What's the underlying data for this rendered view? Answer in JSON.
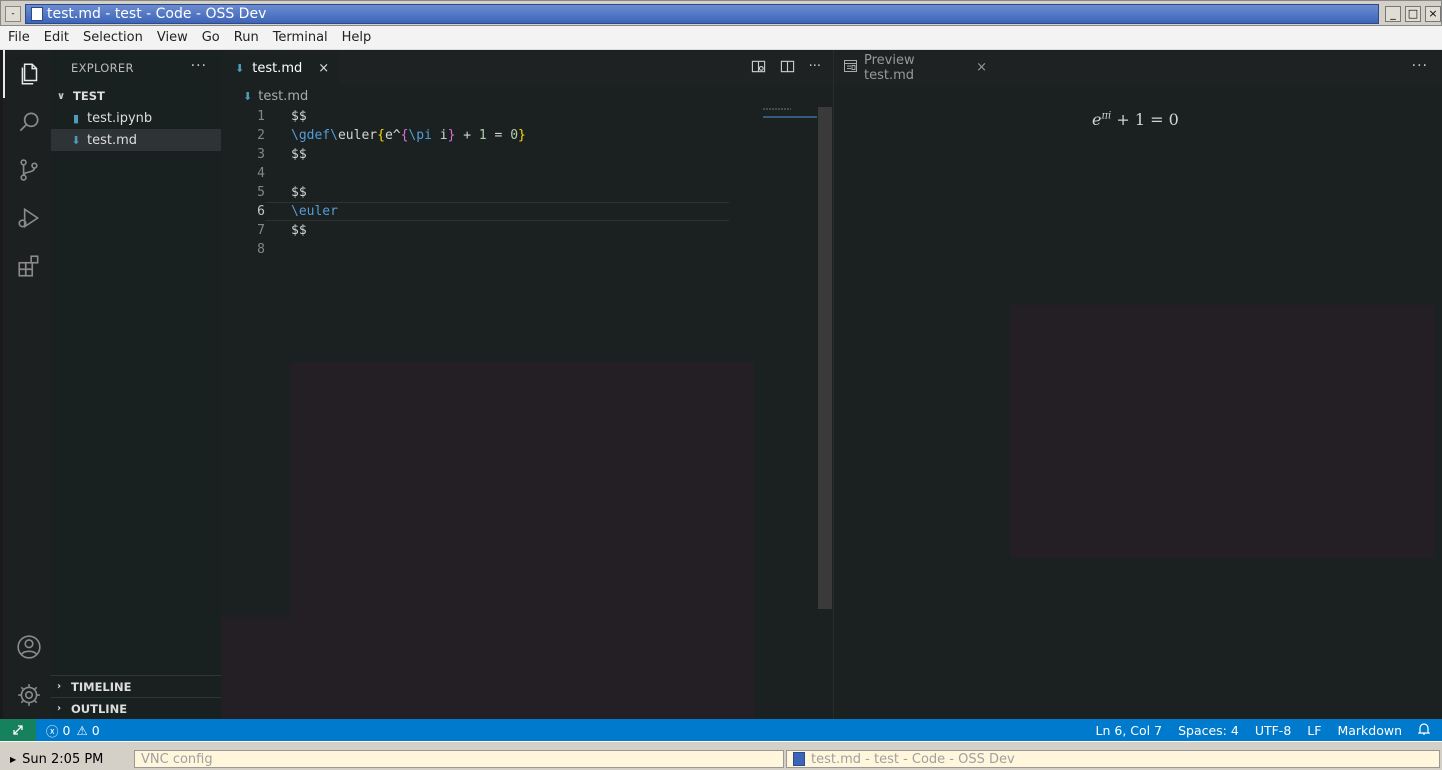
{
  "window": {
    "title": "test.md - test - Code - OSS Dev",
    "sys_button": "-",
    "minimize": "_",
    "maximize": "□",
    "close": "×"
  },
  "menu": [
    "File",
    "Edit",
    "Selection",
    "View",
    "Go",
    "Run",
    "Terminal",
    "Help"
  ],
  "activity_bar": {
    "items": [
      "explorer-icon",
      "search-icon",
      "source-control-icon",
      "run-debug-icon",
      "extensions-icon"
    ],
    "bottom": [
      "account-icon",
      "settings-gear-icon"
    ]
  },
  "sidebar": {
    "title": "EXPLORER",
    "more": "···",
    "folder": "TEST",
    "files": [
      {
        "name": "test.ipynb",
        "icon": "notebook-icon"
      },
      {
        "name": "test.md",
        "icon": "markdown-icon",
        "selected": true
      }
    ],
    "timeline": "TIMELINE",
    "outline": "OUTLINE"
  },
  "editor": {
    "tab_label": "test.md",
    "tab_close": "×",
    "breadcrumb": "test.md",
    "more": "···",
    "lines": [
      {
        "n": "1",
        "text": "$$"
      },
      {
        "n": "2",
        "text": "\\gdef\\euler{e^{\\pi i} + 1 = 0}"
      },
      {
        "n": "3",
        "text": "$$"
      },
      {
        "n": "4",
        "text": ""
      },
      {
        "n": "5",
        "text": "$$"
      },
      {
        "n": "6",
        "text": "\\euler"
      },
      {
        "n": "7",
        "text": "$$"
      },
      {
        "n": "8",
        "text": ""
      }
    ],
    "current_line": 6
  },
  "preview": {
    "tab_label": "Preview test.md",
    "tab_close": "×",
    "more": "···",
    "math_base": "e",
    "math_sup": "πi",
    "math_rest": " + 1 = 0"
  },
  "status": {
    "remote": "⚡",
    "errors": "0",
    "warnings": "0",
    "position": "Ln 6, Col 7",
    "spaces": "Spaces: 4",
    "encoding": "UTF-8",
    "eol": "LF",
    "language": "Markdown",
    "bell": "🔔"
  },
  "taskbar": {
    "clock": "Sun  2:05 PM",
    "slot1": "VNC config",
    "slot2": "test.md - test - Code - OSS Dev"
  },
  "colors": {
    "status_bar": "#007acc",
    "remote_indicator": "#16825d",
    "keyword": "#569cd6",
    "bracket_gold": "#ffd700",
    "bracket_pink": "#da70d6",
    "number": "#b5cea8"
  }
}
